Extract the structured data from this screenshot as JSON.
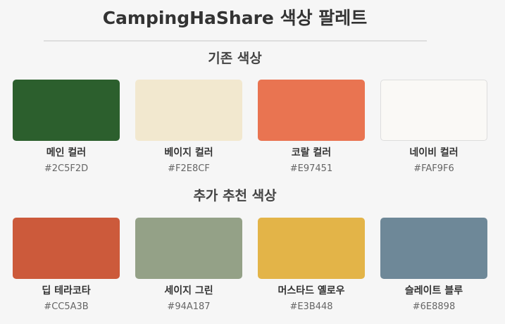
{
  "title": "CampingHaShare 색상 팔레트",
  "sections": [
    {
      "title": "기존 색상",
      "colors": [
        {
          "name": "메인 컬러",
          "hex": "#2C5F2D"
        },
        {
          "name": "베이지 컬러",
          "hex": "#F2E8CF"
        },
        {
          "name": "코랄 컬러",
          "hex": "#E97451"
        },
        {
          "name": "네이비 컬러",
          "hex": "#FAF9F6"
        }
      ]
    },
    {
      "title": "추가 추천 색상",
      "colors": [
        {
          "name": "딥 테라코타",
          "hex": "#CC5A3B"
        },
        {
          "name": "세이지 그린",
          "hex": "#94A187"
        },
        {
          "name": "머스타드 옐로우",
          "hex": "#E3B448"
        },
        {
          "name": "슬레이트 블루",
          "hex": "#6E8898"
        }
      ]
    }
  ]
}
